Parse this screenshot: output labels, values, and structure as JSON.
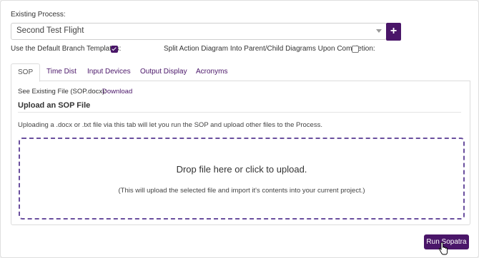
{
  "process": {
    "label": "Existing Process:",
    "selected": "Second Test Flight",
    "add_label": "+"
  },
  "options": {
    "default_branch_label": "Use the Default Branch Templates:",
    "default_branch_checked": true,
    "split_diagram_label": "Split Action Diagram Into Parent/Child Diagrams Upon Completion:",
    "split_diagram_checked": false
  },
  "tabs": [
    {
      "label": "SOP",
      "active": true
    },
    {
      "label": "Time Dist",
      "active": false
    },
    {
      "label": "Input Devices",
      "active": false
    },
    {
      "label": "Output Display",
      "active": false
    },
    {
      "label": "Acronyms",
      "active": false
    }
  ],
  "sop": {
    "existing_file_label": "See Existing File (SOP.docx):",
    "download_link": "Download",
    "upload_title": "Upload an SOP File",
    "upload_desc": "Uploading a .docx or .txt file via this tab will let you run the SOP and upload other files to the Process.",
    "drop_main": "Drop file here or click to upload.",
    "drop_sub": "(This will upload the selected file and import it's contents into your current project.)"
  },
  "actions": {
    "run_label": "Run Sopatra"
  },
  "colors": {
    "accent": "#4a1669",
    "dropzone_border": "#6a4f9e"
  }
}
